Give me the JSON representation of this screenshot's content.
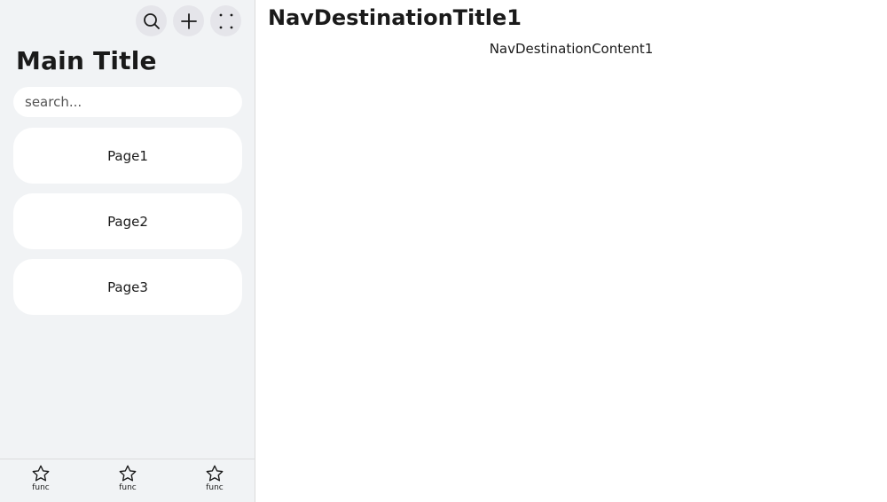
{
  "sidebar": {
    "toolbar": [
      {
        "icon": "search-icon"
      },
      {
        "icon": "plus-icon"
      },
      {
        "icon": "more-icon"
      }
    ],
    "title": "Main Title",
    "search": {
      "placeholder": "search...",
      "value": ""
    },
    "pages": [
      {
        "label": "Page1"
      },
      {
        "label": "Page2"
      },
      {
        "label": "Page3"
      }
    ],
    "bottom_tabs": [
      {
        "label": "func",
        "icon": "star-icon"
      },
      {
        "label": "func",
        "icon": "star-icon"
      },
      {
        "label": "func",
        "icon": "star-icon"
      }
    ]
  },
  "destination": {
    "title": "NavDestinationTitle1",
    "content": "NavDestinationContent1"
  },
  "colors": {
    "sidebar_bg": "#f1f3f5",
    "button_bg": "#e5e5ea",
    "card_bg": "#ffffff"
  }
}
